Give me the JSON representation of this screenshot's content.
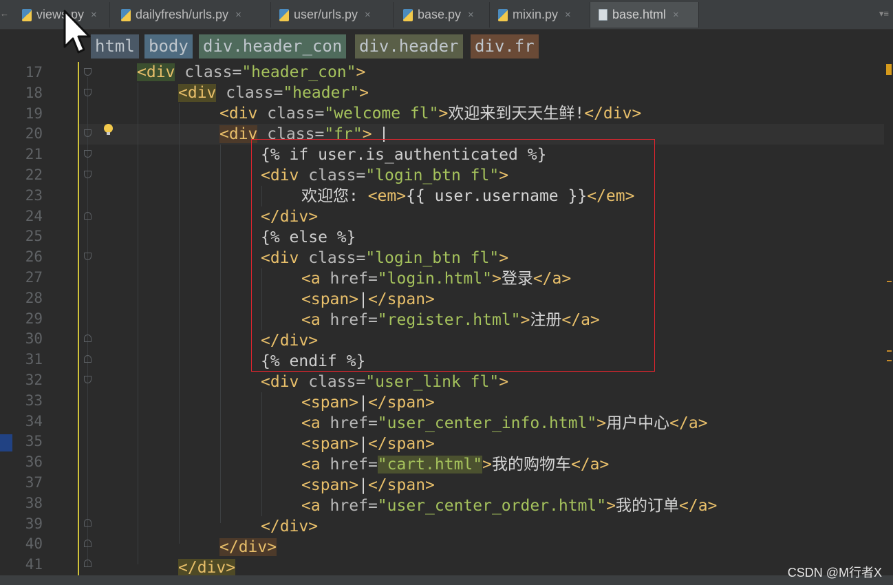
{
  "tabs": [
    {
      "label": "views.py",
      "icon": "python-file-icon"
    },
    {
      "label": "dailyfresh/urls.py",
      "icon": "python-file-icon"
    },
    {
      "label": "user/urls.py",
      "icon": "python-file-icon"
    },
    {
      "label": "base.py",
      "icon": "python-file-icon"
    },
    {
      "label": "mixin.py",
      "icon": "python-file-icon"
    },
    {
      "label": "base.html",
      "icon": "html-file-icon",
      "active": true
    }
  ],
  "tab_close": "×",
  "tab_menu": "▾≡",
  "left_stub": "←",
  "left_number": "18",
  "breadcrumb": [
    "html",
    "body",
    "div.header_con",
    "div.header",
    "div.fr"
  ],
  "line_numbers": [
    "17",
    "18",
    "19",
    "20",
    "21",
    "22",
    "23",
    "24",
    "25",
    "26",
    "27",
    "28",
    "29",
    "30",
    "31",
    "32",
    "33",
    "34",
    "35",
    "36",
    "37",
    "38",
    "39",
    "40",
    "41"
  ],
  "code": {
    "l17": {
      "open": "<div",
      "attr": " class=",
      "val": "\"header_con\"",
      "close": ">"
    },
    "l18": {
      "open": "<div",
      "attr": " class=",
      "val": "\"header\"",
      "close": ">"
    },
    "l19": {
      "open": "<div",
      "attr": " class=",
      "val": "\"welcome fl\"",
      "close": ">",
      "text": "欢迎来到天天生鲜!",
      "end": "</div>"
    },
    "l20": {
      "open": "<div",
      "attr": " class=",
      "val": "\"fr\"",
      "close": ">"
    },
    "l21": "{% if user.is_authenticated %}",
    "l22": {
      "open": "<div",
      "attr": " class=",
      "val": "\"login_btn fl\"",
      "close": ">"
    },
    "l23": {
      "text": "欢迎您: ",
      "open": "<em>",
      "expr": "{{ user.username }}",
      "end": "</em>"
    },
    "l24": "</div>",
    "l25": "{% else %}",
    "l26": {
      "open": "<div",
      "attr": " class=",
      "val": "\"login_btn fl\"",
      "close": ">"
    },
    "l27": {
      "open": "<a",
      "attr": " href=",
      "val": "\"login.html\"",
      "close": ">",
      "text": "登录",
      "end": "</a>"
    },
    "l28": {
      "open": "<span>",
      "text": "|",
      "end": "</span>"
    },
    "l29": {
      "open": "<a",
      "attr": " href=",
      "val": "\"register.html\"",
      "close": ">",
      "text": "注册",
      "end": "</a>"
    },
    "l30": "</div>",
    "l31": "{% endif %}",
    "l32": {
      "open": "<div",
      "attr": " class=",
      "val": "\"user_link fl\"",
      "close": ">"
    },
    "l33": {
      "open": "<span>",
      "text": "|",
      "end": "</span>"
    },
    "l34": {
      "open": "<a",
      "attr": " href=",
      "val": "\"user_center_info.html\"",
      "close": ">",
      "text": "用户中心",
      "end": "</a>"
    },
    "l35": {
      "open": "<span>",
      "text": "|",
      "end": "</span>"
    },
    "l36": {
      "open": "<a",
      "attr": " href=",
      "val": "\"cart.html\"",
      "close": ">",
      "text": "我的购物车",
      "end": "</a>"
    },
    "l37": {
      "open": "<span>",
      "text": "|",
      "end": "</span>"
    },
    "l38": {
      "open": "<a",
      "attr": " href=",
      "val": "\"user_center_order.html\"",
      "close": ">",
      "text": "我的订单",
      "end": "</a>"
    },
    "l39": "</div>",
    "l40": "</div>",
    "l41": "</div>"
  },
  "watermark": "CSDN @M行者X",
  "colors": {
    "background": "#2b2b2b",
    "tag": "#e8bf6a",
    "attribute": "#bababa",
    "string": "#a5c25c",
    "highlight_box": "#e0252e"
  }
}
